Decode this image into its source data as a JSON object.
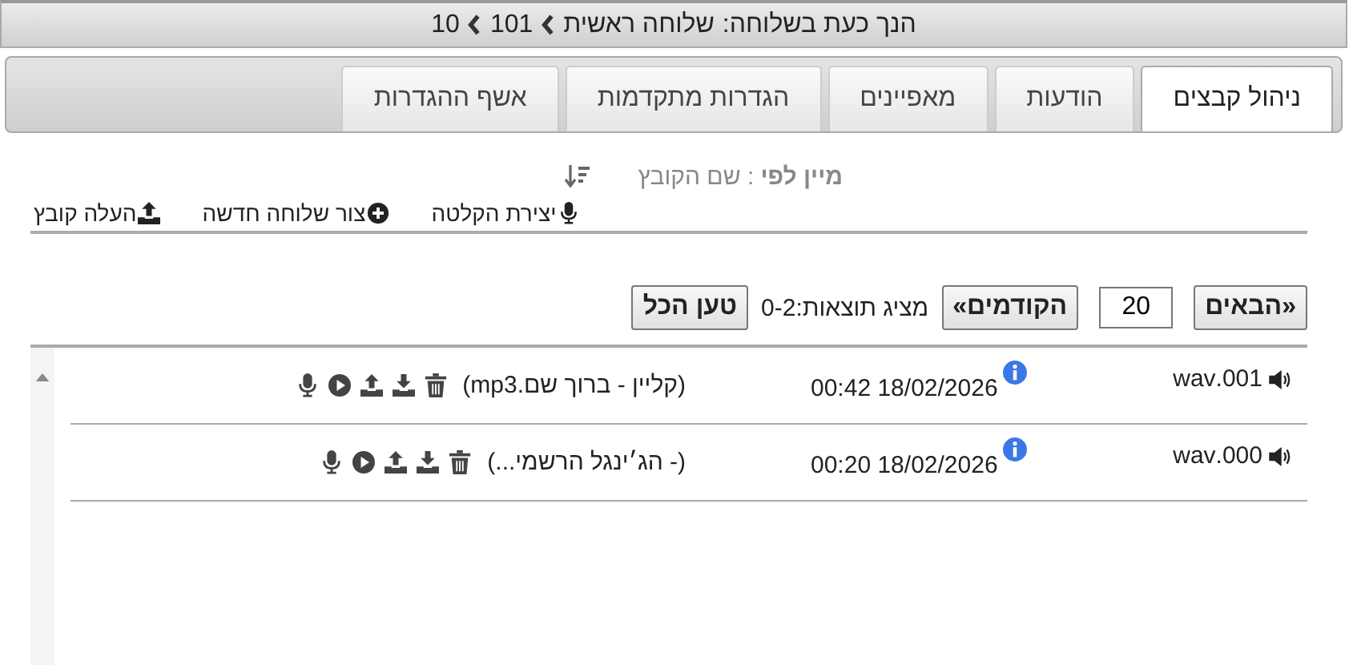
{
  "breadcrumb": {
    "label": "הנך כעת בשלוחה:",
    "path": [
      "שלוחה ראשית",
      "101",
      "10"
    ]
  },
  "tabs": [
    {
      "label": "ניהול קבצים",
      "selected": true
    },
    {
      "label": "הודעות",
      "selected": false
    },
    {
      "label": "מאפיינים",
      "selected": false
    },
    {
      "label": "הגדרות מתקדמות",
      "selected": false
    },
    {
      "label": "אשף ההגדרות",
      "selected": false
    }
  ],
  "sort": {
    "text": "**מיין לפי** : שם הקובץ"
  },
  "toolbar": [
    {
      "kind": "record",
      "label": "יצירת הקלטה"
    },
    {
      "kind": "new",
      "label": "צור שלוחה חדשה"
    },
    {
      "kind": "upload",
      "label": "העלה קובץ"
    }
  ],
  "pagination": {
    "next": "«הבאים",
    "page_size": "20",
    "previous": "הקודמים»",
    "summary": "מציג תוצאות:0-2",
    "load_all": "טען הכל"
  },
  "files": [
    {
      "name": "001.wav",
      "date": "18/02/2026 00:42",
      "title": "(קליין - ברוך שם.mp3)"
    },
    {
      "name": "000.wav",
      "date": "18/02/2026 00:20",
      "title": "(- הג׳ינגל הרשמי...)"
    }
  ]
}
